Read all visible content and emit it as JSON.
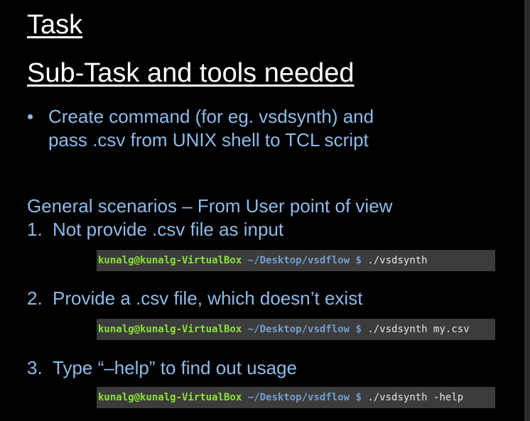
{
  "task_title": "Task",
  "subtask_title": "Sub-Task and tools needed",
  "bullet": {
    "marker": "•",
    "text": "Create command (for eg. vsdsynth) and pass .csv from UNIX shell to TCL script"
  },
  "scenarios_heading": "General scenarios – From User point of view",
  "scenarios": [
    {
      "number": "1.",
      "label": "Not provide .csv file as input",
      "terminal": {
        "user": "kunalg@kunalg-VirtualBox",
        "path": "~/Desktop/vsdflow $",
        "command": "./vsdsynth"
      }
    },
    {
      "number": "2.",
      "label": "Provide a .csv file, which doesn’t exist",
      "terminal": {
        "user": "kunalg@kunalg-VirtualBox",
        "path": "~/Desktop/vsdflow $",
        "command": "./vsdsynth my.csv"
      }
    },
    {
      "number": "3.",
      "label": "Type “–help” to find out usage",
      "terminal": {
        "user": "kunalg@kunalg-VirtualBox",
        "path": "~/Desktop/vsdflow $",
        "command": "./vsdsynth -help"
      }
    }
  ]
}
